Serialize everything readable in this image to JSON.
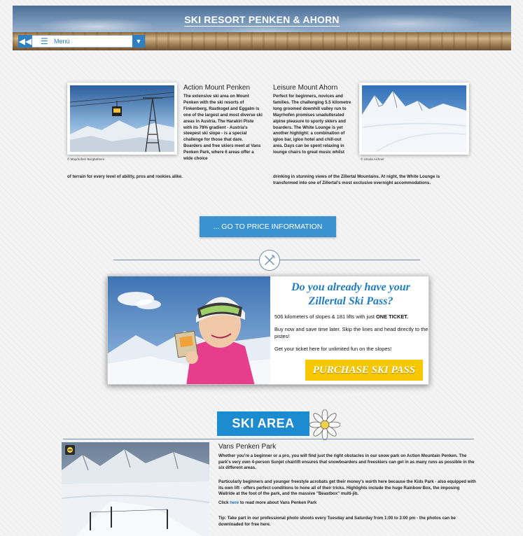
{
  "header": {
    "title": "SKI RESORT PENKEN & AHORN",
    "menu_label": "Menü"
  },
  "penken": {
    "title": "Action Mount Penken",
    "text": "The extensive ski area on Mount Penken with the ski resorts of Finkenberg, Rastkogel and Eggalm is one of the largest and most diverse ski areas in Austria. The Harakiri Piste with its 78% gradient - Austria's steepest ski slope - is a special challenge for those that dare. Boarders and free skiers meet at Vans Penken Park, where 6 areas offer a wide choice",
    "text_tail": "of terrain for every level of ability, pros and rookies alike.",
    "credit": "© Mayrhofner Bergbahnen"
  },
  "ahorn": {
    "title": "Leisure Mount Ahorn",
    "text": "Perfect for beginners, novices and families. The challenging 5.5 kilometre long groomed downhill valley run to Mayrhofen promises unadulterated alpine pleasure to sporty skiers and boarders. The White Lounge is yet another highlight: a combination of igloo bar, igloo hotel and chill-out area. Days can be spent relaxing in lounge chairs to great music whilst",
    "text_tail": "drinking in stunning views of the Zillertal Mountains. At night, the White Lounge is transformed into one of Zillertal's most exclusive overnight accommodations.",
    "credit": "© Ursula Aichner"
  },
  "price_button": "... GO TO PRICE INFORMATION",
  "promo": {
    "title": "Do you already have your Zillertal Ski Pass?",
    "line1_a": "506 kilometers of slopes & 181 lifts with just ",
    "line1_b": "ONE TICKET.",
    "line2": "Buy now and save time later. Skip the lines and head directly to the pistes!",
    "line3": "Get your ticket here for unlimited fun on the slopes!",
    "button": "PURCHASE SKI PASS"
  },
  "ski_area": {
    "banner": "SKI AREA",
    "vans_title": "Vans Penken Park",
    "p1": "Whether you're a beginner or a pro, you will find just the right obstacles in our snow park on Action Mountain Penken. The park's very own 4-person Sunjet chairlift ensures that snowboarders and freeskiers can get in as many runs as possible in the six different areas.",
    "p2": "Particularly beginners and younger freestyle acrobats get their money's worth here because the Kids Park - also equipped with its own lift - offers perfect conditions to hone all of their tricks. Highlights include the huge Rainbow Box, the imposing Wallride at the foot of the park, and the massive \"Beastbox\" multi-jib.",
    "p3_a": "Click ",
    "p3_link": "here",
    "p3_b": "  to read more about Vans Penken Park",
    "tip": "Tip: Take part in our professional photo shoots every Tuesday and Saturday from 1:00 to 3:00 pm - the photos can be downloaded for free here."
  },
  "colors": {
    "accent": "#3a92d0",
    "promo_button": "#f7c800",
    "banner": "#1d8bd0"
  }
}
